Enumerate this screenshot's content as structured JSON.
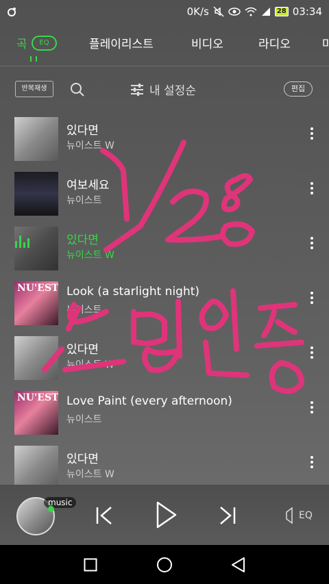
{
  "status_bar": {
    "net_speed": "0K/s",
    "battery": "28",
    "time": "03:34"
  },
  "tabs": [
    {
      "label": "곡",
      "badge": "EQ"
    },
    {
      "label": "플레이리스트"
    },
    {
      "label": "비디오"
    },
    {
      "label": "라디오"
    },
    {
      "label": "마"
    }
  ],
  "toolbar": {
    "repeat_label": "반복재생",
    "sort_label": "내 설정순",
    "edit_label": "편집"
  },
  "songs": [
    {
      "title": "있다면",
      "artist": "뉴이스트 W",
      "art": "gray"
    },
    {
      "title": "여보세요",
      "artist": "뉴이스트",
      "art": "dark"
    },
    {
      "title": "있다면",
      "artist": "뉴이스트 W",
      "art": "gray",
      "playing": true
    },
    {
      "title": "Look (a starlight night)",
      "artist": "뉴이스트",
      "art": "pink",
      "art_text": "NU'EST"
    },
    {
      "title": "있다면",
      "artist": "뉴이스트 W",
      "art": "gray"
    },
    {
      "title": "Love Paint (every afternoon)",
      "artist": "뉴이스트",
      "art": "pink",
      "art_text": "NU'EST"
    },
    {
      "title": "있다면",
      "artist": "뉴이스트 W",
      "art": "gray"
    }
  ],
  "player": {
    "badge": "music",
    "eq_label": "EQ"
  },
  "handwriting": {
    "lines": [
      "1/28",
      "스밍인증"
    ],
    "color": "#e0347a"
  },
  "colors": {
    "accent": "#3ad64a"
  }
}
